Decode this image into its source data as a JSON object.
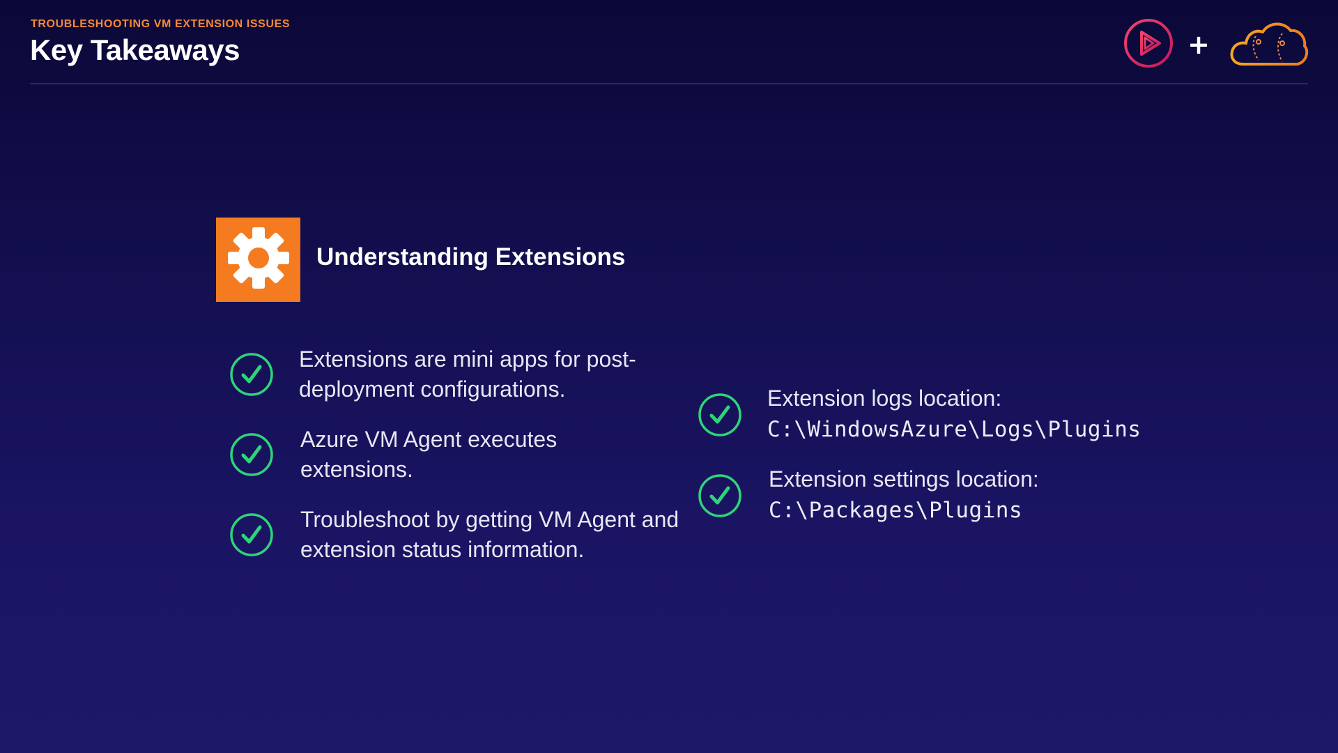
{
  "header": {
    "eyebrow": "TROUBLESHOOTING VM EXTENSION ISSUES",
    "title": "Key Takeaways",
    "plus": "+"
  },
  "section": {
    "icon": "gear-icon",
    "title": "Understanding Extensions"
  },
  "left_items": [
    {
      "text": "Extensions are mini apps for post-deployment configurations."
    },
    {
      "text": "Azure VM Agent executes extensions."
    },
    {
      "text": "Troubleshoot by getting VM Agent and extension status information."
    }
  ],
  "right_items": [
    {
      "label": "Extension logs location:",
      "path": "C:\\WindowsAzure\\Logs\\Plugins"
    },
    {
      "label": "Extension settings location:",
      "path": "C:\\Packages\\Plugins"
    }
  ],
  "colors": {
    "accent_orange": "#f47b20",
    "check_green": "#2ed47a",
    "play_red": "#e5294f",
    "background": "#1a1463"
  }
}
